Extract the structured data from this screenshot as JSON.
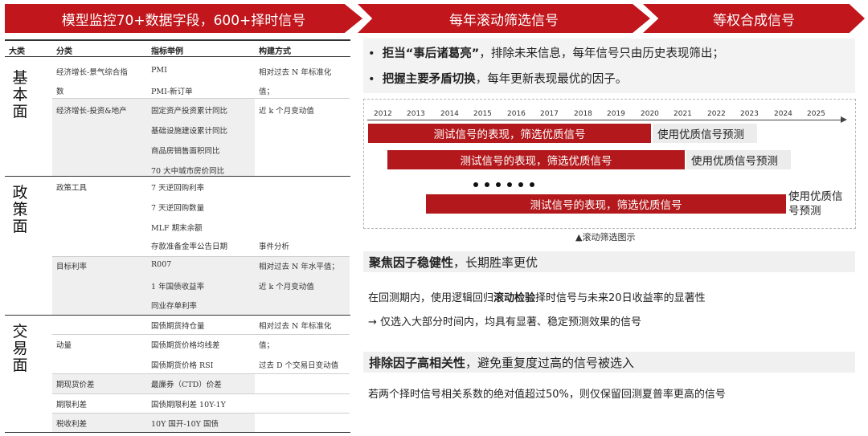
{
  "headers": {
    "h1": "模型监控70+数据字段，600+择时信号",
    "h2": "每年滚动筛选信号",
    "h3": "等权合成信号"
  },
  "table": {
    "col_headers": [
      "大类",
      "分类",
      "指标举例",
      "构建方式"
    ],
    "categories": {
      "c1": "基本面",
      "c2": "政策面",
      "c3": "交易面"
    },
    "rows": [
      {
        "sub": "经济增长-景气综合指",
        "ind": "PMI",
        "build": "相对过去 N 年标准化"
      },
      {
        "sub": "数",
        "ind": "PMI-新订单",
        "build": "值；"
      },
      {
        "sub": "经济增长-投资&地产",
        "ind": "固定资产投资累计同比",
        "build": "近 k 个月变动值"
      },
      {
        "sub": "",
        "ind": "基础设施建设累计同比",
        "build": ""
      },
      {
        "sub": "",
        "ind": "商品房销售面积同比",
        "build": ""
      },
      {
        "sub": "",
        "ind": "70 大中城市房价同比",
        "build": ""
      },
      {
        "sub": "政策工具",
        "ind": "7 天逆回购利率",
        "build": ""
      },
      {
        "sub": "",
        "ind": "7 天逆回购数量",
        "build": ""
      },
      {
        "sub": "",
        "ind": "MLF 期末余额",
        "build": ""
      },
      {
        "sub": "",
        "ind": "存款准备金率公告日期",
        "build": "事件分析"
      },
      {
        "sub": "目标利率",
        "ind": "R007",
        "build": "相对过去 N 年水平值；"
      },
      {
        "sub": "",
        "ind": "1 年国债收益率",
        "build": "近 k 个月变动值"
      },
      {
        "sub": "",
        "ind": "同业存单利率",
        "build": ""
      },
      {
        "sub": "",
        "ind": "国债期货持仓量",
        "build": "相对过去 N 年标准化"
      },
      {
        "sub": "动量",
        "ind": "国债期货价格均线差",
        "build": "值；"
      },
      {
        "sub": "",
        "ind": "国债期货价格 RSI",
        "build": "过去 D 个交易日变动值"
      },
      {
        "sub": "期现货价差",
        "ind": "最廉券（CTD）价差",
        "build": ""
      },
      {
        "sub": "期限利差",
        "ind": "国债期限利差 10Y-1Y",
        "build": ""
      },
      {
        "sub": "税收利差",
        "ind": "10Y 国开-10Y 国债",
        "build": ""
      }
    ]
  },
  "bullets": {
    "b1_bold": "拒当“事后诸葛亮”",
    "b1_rest": "，排除未来信息，每年信号只由历史表现筛出；",
    "b2_bold": "把握主要矛盾切换",
    "b2_rest": "，每年更新表现最优的因子。"
  },
  "timeline": {
    "years": [
      "2012",
      "2013",
      "2014",
      "2015",
      "2016",
      "2017",
      "2018",
      "2019",
      "2020",
      "2021",
      "2022",
      "2023",
      "2024",
      "2025"
    ],
    "test_label": "测试信号的表现，筛选优质信号",
    "predict_label": "使用优质信号预测",
    "predict_label_wrap1": "使用优质信",
    "predict_label_wrap2": "号预测",
    "caption": "▲滚动筛选图示"
  },
  "section1": {
    "bold": "聚焦因子稳健性",
    "rest": "，长期胜率更优",
    "p1_pre": "在回测期内，使用逻辑回归",
    "p1_bold": "滚动检验",
    "p1_post": "择时信号与未来20日收益率的显著性",
    "p2": "→ 仅选入大部分时间内，均具有显著、稳定预测效果的信号"
  },
  "section2": {
    "bold": "排除因子高相关性",
    "rest": "，避免重复度过高的信号被选入",
    "p1": "若两个择时信号相关系数的绝对值超过50%，则仅保留回测夏普率更高的信号"
  },
  "colors": {
    "red": "#c0161c",
    "grey": "#efefef"
  }
}
